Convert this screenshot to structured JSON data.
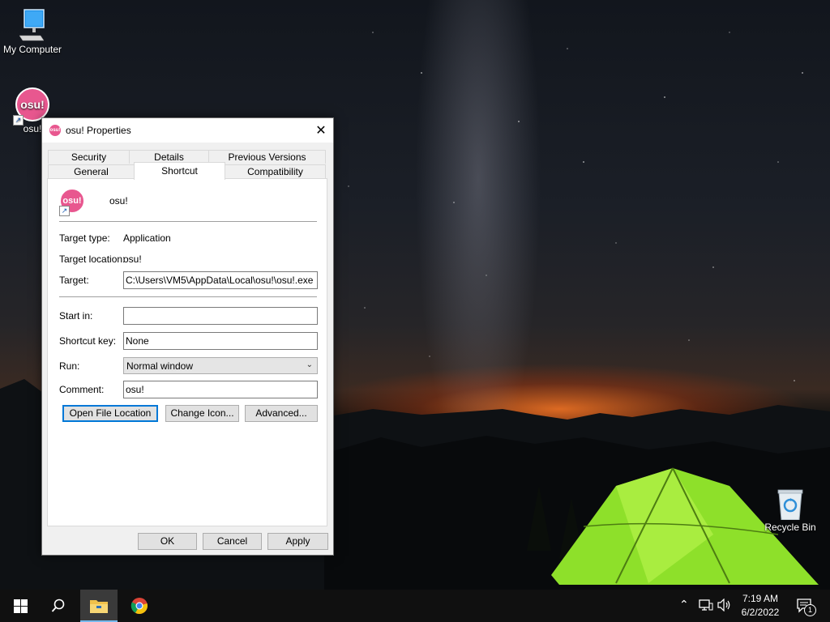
{
  "desktop": {
    "icons": [
      {
        "label": "My Computer",
        "icon": "monitor-icon"
      },
      {
        "label": "osu!",
        "icon": "osu-logo-icon",
        "logo_text": "osu!"
      },
      {
        "label": "Recycle Bin",
        "icon": "recycle-bin-icon"
      }
    ]
  },
  "dialog": {
    "title": "osu! Properties",
    "close_glyph": "✕",
    "tabs_row1": [
      "Security",
      "Details",
      "Previous Versions"
    ],
    "tabs_row2": [
      "General",
      "Shortcut",
      "Compatibility"
    ],
    "active_tab": "Shortcut",
    "app_name": "osu!",
    "logo_text": "osu!",
    "fields": {
      "target_type_label": "Target type:",
      "target_type_value": "Application",
      "target_location_label": "Target location:",
      "target_location_value": "osu!",
      "target_label": "Target:",
      "target_value": "C:\\Users\\VM5\\AppData\\Local\\osu!\\osu!.exe",
      "start_in_label": "Start in:",
      "start_in_value": "",
      "shortcut_key_label": "Shortcut key:",
      "shortcut_key_value": "None",
      "run_label": "Run:",
      "run_value": "Normal window",
      "comment_label": "Comment:",
      "comment_value": "osu!"
    },
    "buttons": {
      "open_file_location": "Open File Location",
      "change_icon": "Change Icon...",
      "advanced": "Advanced...",
      "ok": "OK",
      "cancel": "Cancel",
      "apply": "Apply"
    }
  },
  "taskbar": {
    "time": "7:19 AM",
    "date": "6/2/2022",
    "notification_count": "1",
    "apps": [
      "start-icon",
      "search-icon",
      "file-explorer-icon",
      "chrome-icon"
    ]
  },
  "colors": {
    "osu_pink": "#e8578f",
    "accent": "#0078d7",
    "taskbar": "#101010"
  }
}
